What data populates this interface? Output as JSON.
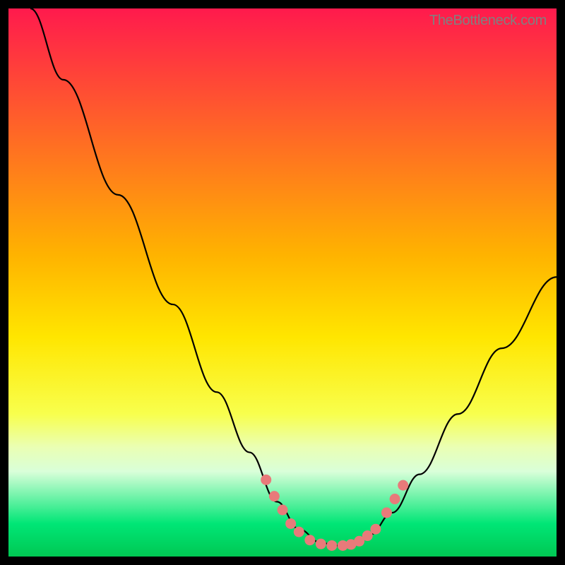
{
  "watermark": "TheBottleneck.com",
  "chart_data": {
    "type": "line",
    "title": "",
    "xlabel": "",
    "ylabel": "",
    "xlim": [
      0,
      100
    ],
    "ylim": [
      0,
      100
    ],
    "gradient_stops": [
      {
        "offset": 0,
        "color": "#ff1a4d"
      },
      {
        "offset": 0.45,
        "color": "#ffb300"
      },
      {
        "offset": 0.6,
        "color": "#ffe600"
      },
      {
        "offset": 0.74,
        "color": "#f8ff4d"
      },
      {
        "offset": 0.8,
        "color": "#eaffb3"
      },
      {
        "offset": 0.845,
        "color": "#d9ffd9"
      },
      {
        "offset": 0.94,
        "color": "#00e676"
      },
      {
        "offset": 1.0,
        "color": "#00c853"
      }
    ],
    "series": [
      {
        "name": "curve",
        "type": "line",
        "points": [
          {
            "x": 4,
            "y": 100
          },
          {
            "x": 10,
            "y": 87
          },
          {
            "x": 20,
            "y": 66
          },
          {
            "x": 30,
            "y": 46
          },
          {
            "x": 38,
            "y": 30
          },
          {
            "x": 44,
            "y": 19
          },
          {
            "x": 49,
            "y": 10
          },
          {
            "x": 53,
            "y": 5
          },
          {
            "x": 57,
            "y": 2.5
          },
          {
            "x": 60,
            "y": 2
          },
          {
            "x": 63,
            "y": 2.5
          },
          {
            "x": 66,
            "y": 4
          },
          {
            "x": 70,
            "y": 8
          },
          {
            "x": 75,
            "y": 15
          },
          {
            "x": 82,
            "y": 26
          },
          {
            "x": 90,
            "y": 38
          },
          {
            "x": 100,
            "y": 51
          }
        ]
      },
      {
        "name": "markers",
        "type": "scatter",
        "color": "#e87a7a",
        "points": [
          {
            "x": 47,
            "y": 14
          },
          {
            "x": 48.5,
            "y": 11
          },
          {
            "x": 50,
            "y": 8.5
          },
          {
            "x": 51.5,
            "y": 6
          },
          {
            "x": 53,
            "y": 4.5
          },
          {
            "x": 55,
            "y": 3
          },
          {
            "x": 57,
            "y": 2.3
          },
          {
            "x": 59,
            "y": 2
          },
          {
            "x": 61,
            "y": 2
          },
          {
            "x": 62.5,
            "y": 2.2
          },
          {
            "x": 64,
            "y": 2.8
          },
          {
            "x": 65.5,
            "y": 3.8
          },
          {
            "x": 67,
            "y": 5
          },
          {
            "x": 69,
            "y": 8
          },
          {
            "x": 70.5,
            "y": 10.5
          },
          {
            "x": 72,
            "y": 13
          }
        ]
      }
    ]
  }
}
